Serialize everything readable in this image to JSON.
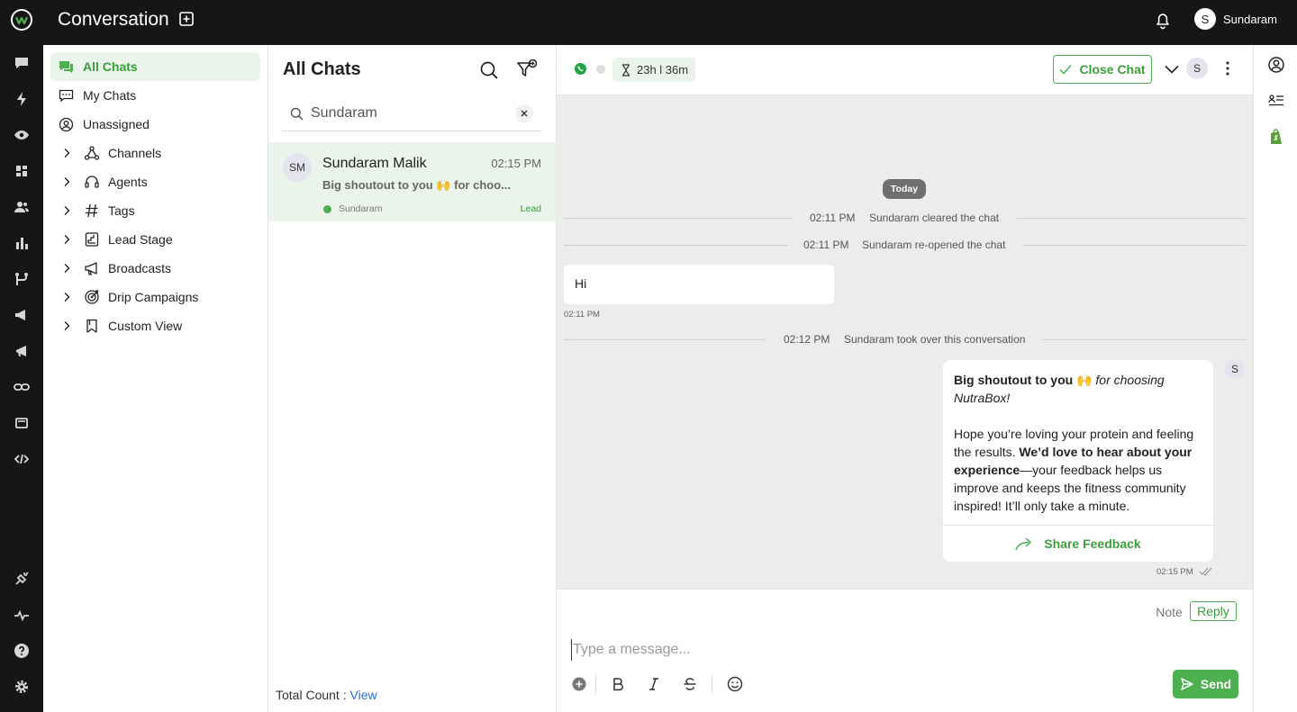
{
  "app": {
    "title": "Conversation",
    "user_initial": "S",
    "user_name": "Sundaram",
    "accent_color": "#4caf50",
    "topbar_color": "#161616"
  },
  "left_rail": {
    "icons": [
      "chat-icon",
      "bolt-icon",
      "eye-icon",
      "dashboard-icon",
      "contacts-icon",
      "reports-icon",
      "flows-icon",
      "campaign-icon",
      "broadcast-icon",
      "link-icon",
      "templates-icon",
      "code-icon",
      "integrations-icon",
      "activity-icon",
      "help-icon",
      "settings-icon"
    ]
  },
  "sidebar": {
    "items": [
      {
        "label": "All Chats",
        "icon": "chats-icon",
        "active": true
      },
      {
        "label": "My Chats",
        "icon": "my-chats-icon"
      },
      {
        "label": "Unassigned",
        "icon": "unassigned-icon"
      }
    ],
    "groups": [
      {
        "label": "Channels",
        "icon": "channels-icon"
      },
      {
        "label": "Agents",
        "icon": "headset-icon"
      },
      {
        "label": "Tags",
        "icon": "hash-icon"
      },
      {
        "label": "Lead Stage",
        "icon": "lead-stage-icon"
      },
      {
        "label": "Broadcasts",
        "icon": "megaphone-icon"
      },
      {
        "label": "Drip Campaigns",
        "icon": "target-icon"
      },
      {
        "label": "Custom View",
        "icon": "bookmark-icon"
      }
    ]
  },
  "chat_list": {
    "title": "All Chats",
    "search_value": "Sundaram",
    "conversations": [
      {
        "initials": "SM",
        "name": "Sundaram Malik",
        "time": "02:15 PM",
        "preview": "Big shoutout to you 🙌 for choo...",
        "agent": "Sundaram",
        "tag": "Lead"
      }
    ],
    "total_label": "Total Count :",
    "total_link": "View"
  },
  "chat": {
    "timer": "23h l 36m",
    "close_label": "Close Chat",
    "assignee_initial": "S",
    "today_label": "Today",
    "events": [
      {
        "time": "02:11 PM",
        "text": "Sundaram cleared the chat"
      },
      {
        "time": "02:11 PM",
        "text": "Sundaram re-opened the chat"
      },
      {
        "time": "02:12 PM",
        "text": "Sundaram took over this conversation"
      }
    ],
    "incoming": {
      "text": "Hi",
      "time": "02:11 PM"
    },
    "outgoing": {
      "bold1": "Big shoutout to you 🙌",
      "italic1": "for choosing NutraBox!",
      "p2a": "Hope you’re loving your protein and feeling the results.",
      "bold2": "We’d love to hear about your experience",
      "p2b": "—your feedback helps us improve and keeps the fitness community inspired! It’ll only take a minute.",
      "button": "Share Feedback",
      "time": "02:15 PM",
      "sender_initial": "S"
    }
  },
  "composer": {
    "note_label": "Note",
    "reply_label": "Reply",
    "placeholder": "Type a message...",
    "send_label": "Send"
  }
}
